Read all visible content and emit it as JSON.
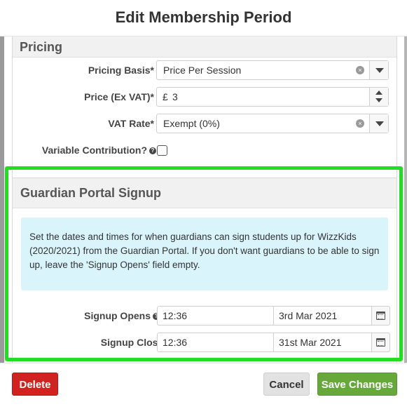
{
  "modal": {
    "title": "Edit Membership Period"
  },
  "pricing": {
    "heading": "Pricing",
    "basis_label": "Pricing Basis*",
    "basis_value": "Price Per Session",
    "price_label": "Price (Ex VAT)*",
    "currency": "£",
    "price_value": "3",
    "vat_label": "VAT Rate*",
    "vat_value": "Exempt (0%)",
    "variable_label": "Variable Contribution?",
    "variable_checked": false
  },
  "guardian": {
    "heading": "Guardian Portal Signup",
    "info": "Set the dates and times for when guardians can sign students up for WizzKids (2020/2021) from the Guardian Portal. If you don't want guardians to be able to sign up, leave the 'Signup Opens' field empty.",
    "opens_label": "Signup Opens",
    "opens_time": "12:36",
    "opens_date": "3rd Mar 2021",
    "closes_label": "Signup Closes",
    "closes_time": "12:36",
    "closes_date": "31st Mar 2021"
  },
  "footer": {
    "delete_label": "Delete",
    "cancel_label": "Cancel",
    "save_label": "Save Changes"
  },
  "colors": {
    "highlight": "#22dd22",
    "delete": "#d0221f",
    "save": "#67a83b",
    "info_bg": "#d9f4fb"
  },
  "icons": {
    "clear": "clear-icon",
    "dropdown": "chevron-down-icon",
    "help": "help-icon",
    "calendar": "calendar-icon",
    "stepper": "stepper-icon"
  }
}
